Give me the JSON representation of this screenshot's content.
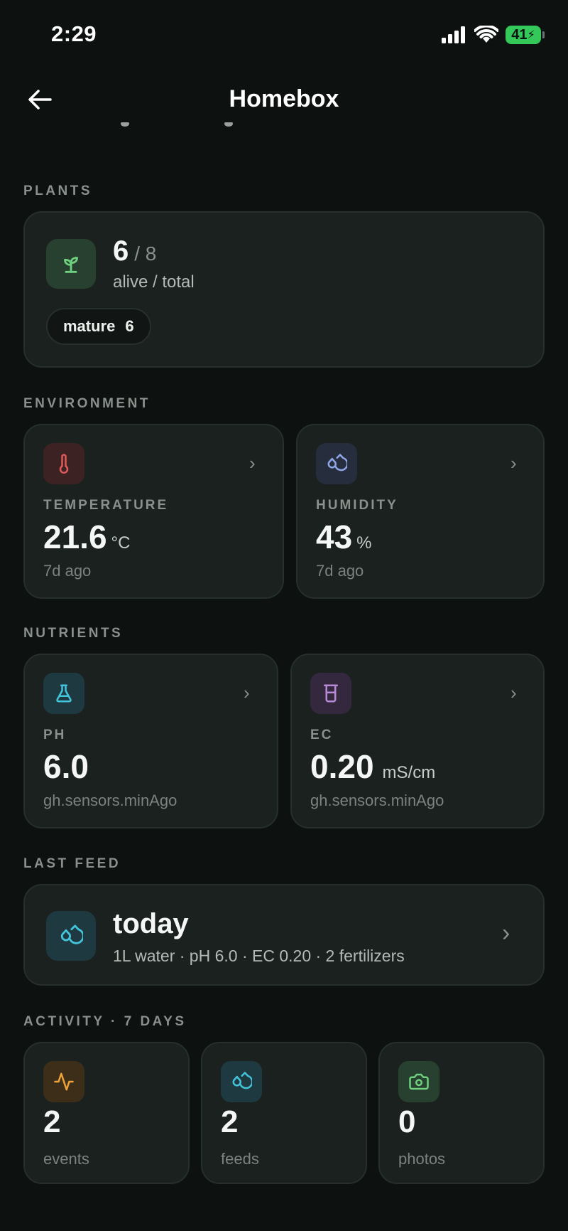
{
  "status": {
    "time": "2:29",
    "battery": "41"
  },
  "nav": {
    "title": "Homebox"
  },
  "plants": {
    "section": "PLANTS",
    "alive": "6",
    "total": "/ 8",
    "caption": "alive / total",
    "stage": {
      "label": "mature",
      "count": "6"
    }
  },
  "environment": {
    "section": "ENVIRONMENT",
    "temperature": {
      "label": "TEMPERATURE",
      "value": "21.6",
      "unit": "°C",
      "ago": "7d ago"
    },
    "humidity": {
      "label": "HUMIDITY",
      "value": "43",
      "unit": "%",
      "ago": "7d ago"
    }
  },
  "nutrients": {
    "section": "NUTRIENTS",
    "ph": {
      "label": "PH",
      "value": "6.0",
      "ago": "gh.sensors.minAgo"
    },
    "ec": {
      "label": "EC",
      "value": "0.20",
      "unit": "mS/cm",
      "ago": "gh.sensors.minAgo"
    }
  },
  "last_feed": {
    "section": "LAST FEED",
    "when": "today",
    "details": "1L water · pH 6.0 · EC 0.20 · 2 fertilizers"
  },
  "activity": {
    "section": "ACTIVITY · 7 DAYS",
    "events": {
      "value": "2",
      "label": "events"
    },
    "feeds": {
      "value": "2",
      "label": "feeds"
    },
    "photos": {
      "value": "0",
      "label": "photos"
    }
  },
  "colors": {
    "background": "#0d1110",
    "card": "#1a211f",
    "plant_green": "#6fd07f",
    "temp_red": "#e05a5a",
    "humidity_blue": "#8fa6e8",
    "ph_cyan": "#44c4dc",
    "ec_purple": "#b98ad6",
    "events_orange": "#f0a23a",
    "photos_green": "#6fd07f"
  },
  "icons": {
    "back": "arrow-left-icon",
    "plant": "sprout-icon",
    "temperature": "thermometer-icon",
    "humidity": "droplets-icon",
    "ph": "flask-icon",
    "ec": "beaker-icon",
    "feed": "droplets-icon",
    "events": "activity-pulse-icon",
    "photos": "camera-icon",
    "chevron": "chevron-right-icon"
  }
}
